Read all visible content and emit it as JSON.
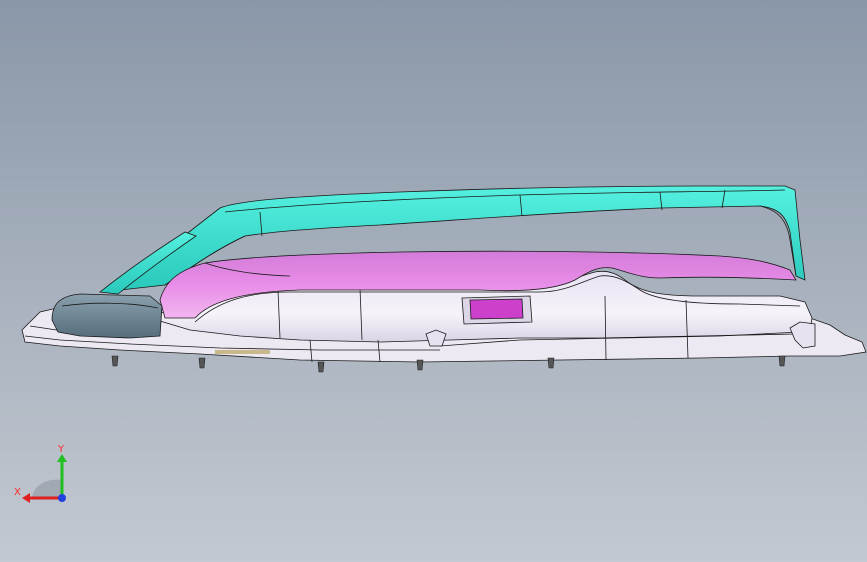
{
  "viewport": {
    "background_top": "#8a97a8",
    "background_bottom": "#c3c9d1"
  },
  "model": {
    "colors": {
      "frame": "#3fe0d0",
      "cushion": "#e070d8",
      "bolster": "#6f8796",
      "body": "#f1eef6",
      "button": "#cc40cc",
      "edge": "#1a1a1a"
    }
  },
  "triad": {
    "x_label": "X",
    "y_label": "Y",
    "x_color": "#e02020",
    "y_color": "#20c020",
    "z_color": "#2040e0"
  }
}
